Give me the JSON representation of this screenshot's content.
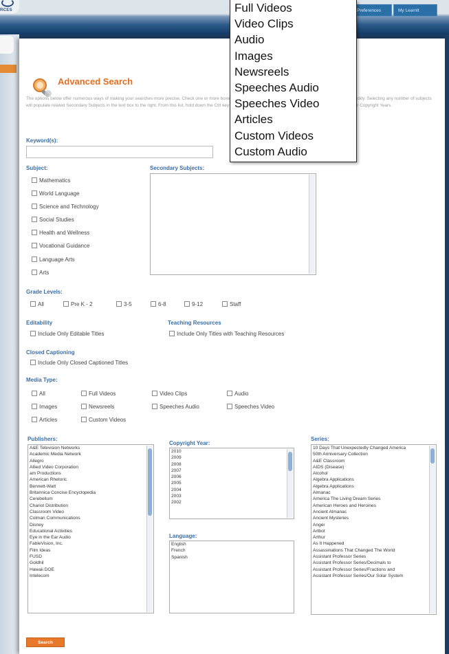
{
  "header": {
    "logo_text": "RCES",
    "nav": [
      "Preferences",
      "My LearnIt"
    ]
  },
  "page": {
    "title": "Advanced Search",
    "intro": "The options below offer numerous ways of making your searches more precise. Check one or more boxes in Subject, Grade Level and Type to get more useful results, quickly. Selecting any number of subjects will populate related Secondary Subjects in the text box to the right. From this list, hold down the Ctrl key (Command key for Macintosh) to select multiple Publishers and/or Copyright Years."
  },
  "keywords": {
    "label": "Keyword(s):",
    "value": ""
  },
  "subject": {
    "label": "Subject:",
    "items": [
      "Mathematics",
      "World Language",
      "Science and Technology",
      "Social Studies",
      "Health and Wellness",
      "Vocational Guidance",
      "Language Arts",
      "Arts"
    ]
  },
  "secondary_subjects": {
    "label": "Secondary Subjects:"
  },
  "grade_levels": {
    "label": "Grade Levels:",
    "items": [
      "All",
      "Pre K - 2",
      "3-5",
      "6-8",
      "9-12",
      "Staff"
    ]
  },
  "editability": {
    "label": "Editability",
    "option": "Include Only Editable Titles"
  },
  "teaching_resources": {
    "label": "Teaching Resources",
    "option": "Include Only Titles with Teaching Resources"
  },
  "closed_captioning": {
    "label": "Closed Captioning",
    "option": "Include Only Closed Captioned Titles"
  },
  "media_type": {
    "label": "Media Type:",
    "items": [
      "All",
      "Full Videos",
      "Video Clips",
      "Audio",
      "Images",
      "Newsreels",
      "Speeches Audio",
      "Speeches Video",
      "Articles",
      "Custom Videos"
    ]
  },
  "publishers": {
    "label": "Publishers:",
    "items": [
      "A&E Television Networks",
      "Academic Media Network",
      "Allegro",
      "Allied Video Corporation",
      "am Productions",
      "American Rhetoric",
      "Bennett-Watt",
      "Britannica Concise Encyclopedia",
      "Cerebellum",
      "Chariot Distribution",
      "Classroom Video",
      "Colman Communications",
      "Disney",
      "Educational Activities",
      "Eye in the Ear Audio",
      "FableVision, Inc.",
      "Film Ideas",
      "FUSD",
      "Goldhil",
      "Hawaii DOE",
      "Intelecom"
    ]
  },
  "copyright_year": {
    "label": "Copyright Year:",
    "items": [
      "2010",
      "2009",
      "2008",
      "2007",
      "2006",
      "2005",
      "2004",
      "2003",
      "2002"
    ]
  },
  "language": {
    "label": "Language:",
    "items": [
      "English",
      "French",
      "Spanish"
    ]
  },
  "series": {
    "label": "Series:",
    "items": [
      "10 Days That Unexpectedly Changed America",
      "50th Anniversary Collection",
      "A&E Classroom",
      "AIDS (Disease)",
      "Alcohol",
      "Algebra Applications",
      "Algebra Applications",
      "Almanac",
      "America The Living Dream Series",
      "American Heroes and Heroines",
      "Ancient Almanac",
      "Ancient Mysteries",
      "Anger",
      "Artbot",
      "Arthur",
      "As It Happened",
      "Assassinations That Changed The World",
      "Assistant Professor Series",
      "Assistant Professor Series/Decimals to",
      "Assistant Professor Series/Fractions and",
      "Assistant Professor Series/Our Solar System"
    ]
  },
  "search_button": "Search",
  "media_dropdown": {
    "options": [
      "Full Videos",
      "Video Clips",
      "Audio",
      "Images",
      "Newsreels",
      "Speeches Audio",
      "Speeches Video",
      "Articles",
      "Custom Videos",
      "Custom Audio"
    ]
  }
}
